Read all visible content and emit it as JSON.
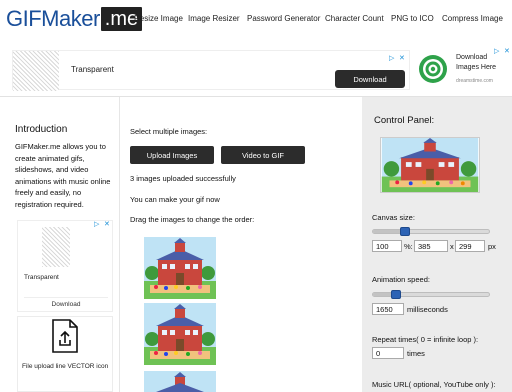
{
  "header": {
    "logo_main": "GIFMaker",
    "logo_tld": ".me",
    "nav": [
      "Resize Image",
      "Image Resizer",
      "Password Generator",
      "Character Count",
      "PNG to ICO",
      "Compress Image"
    ]
  },
  "ad_top": {
    "label": "Transparent",
    "button": "Download",
    "right_title": "Download Images Here",
    "right_source": "dreamstime.com"
  },
  "intro": {
    "title": "Introduction",
    "text": "GIFMaker.me allows you to create animated gifs, slideshows, and video animations with music online freely and easily, no registration required."
  },
  "ad_side": {
    "label": "Transparent",
    "button": "Download"
  },
  "file_box": {
    "caption": "File upload line VECTOR icon"
  },
  "main": {
    "select_label": "Select multiple images:",
    "upload_button": "Upload Images",
    "video_button": "Video to GIF",
    "uploaded_status": "3 images uploaded successfully",
    "make_gif_hint": "You can make your gif now",
    "drag_hint": "Drag the images to change the order:"
  },
  "control_panel": {
    "title": "Control Panel:",
    "canvas_size_label": "Canvas size:",
    "canvas_percent": "100",
    "canvas_percent_unit": "%:",
    "canvas_width": "385",
    "canvas_x": "x",
    "canvas_height": "299",
    "canvas_unit": "px",
    "canvas_slider_level": 0.25,
    "animation_speed_label": "Animation speed:",
    "speed_value": "1650",
    "speed_unit": "milliseconds",
    "speed_slider_level": 0.17,
    "repeat_label": "Repeat times( 0 = infinite loop ):",
    "repeat_value": "0",
    "repeat_unit": "times",
    "music_label": "Music URL( optional, YouTube only ):"
  },
  "colors": {
    "logo_blue": "#1a4f9a",
    "dark_button": "#2c2c2c",
    "slider_knob": "#2d63b5",
    "panel_bg": "#ececec"
  }
}
